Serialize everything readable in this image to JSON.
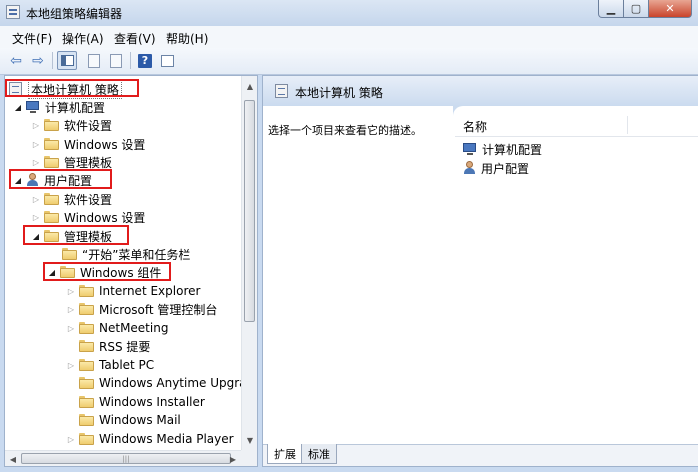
{
  "window": {
    "title": "本地组策略编辑器",
    "min_label": "▁",
    "max_label": "▢",
    "close_label": "✕"
  },
  "menu": [
    "文件(F)",
    "操作(A)",
    "查看(V)",
    "帮助(H)"
  ],
  "toolbar": {
    "back_icon": "back-arrow-icon",
    "forward_icon": "forward-arrow-icon",
    "help_glyph": "?"
  },
  "tree": {
    "root": "本地计算机 策略",
    "computer_config": "计算机配置",
    "cc_software": "软件设置",
    "cc_windows": "Windows 设置",
    "cc_admin": "管理模板",
    "user_config": "用户配置",
    "uc_software": "软件设置",
    "uc_windows": "Windows 设置",
    "uc_admin": "管理模板",
    "start_menu": "“开始”菜单和任务栏",
    "win_components": "Windows 组件",
    "components": [
      {
        "label": "Internet Explorer",
        "expandable": true
      },
      {
        "label": "Microsoft 管理控制台",
        "expandable": true
      },
      {
        "label": "NetMeeting",
        "expandable": true
      },
      {
        "label": "RSS 提要",
        "expandable": false
      },
      {
        "label": "Tablet PC",
        "expandable": true
      },
      {
        "label": "Windows Anytime Upgrad",
        "expandable": false
      },
      {
        "label": "Windows Installer",
        "expandable": false
      },
      {
        "label": "Windows Mail",
        "expandable": false
      },
      {
        "label": "Windows Media Player",
        "expandable": true
      }
    ]
  },
  "right": {
    "header_title": "本地计算机 策略",
    "description": "选择一个项目来查看它的描述。",
    "column_name": "名称",
    "items": [
      "计算机配置",
      "用户配置"
    ],
    "tabs": [
      "扩展",
      "标准"
    ]
  },
  "colors": {
    "highlight": "#e11b1b",
    "frame": "#c9daf0"
  }
}
